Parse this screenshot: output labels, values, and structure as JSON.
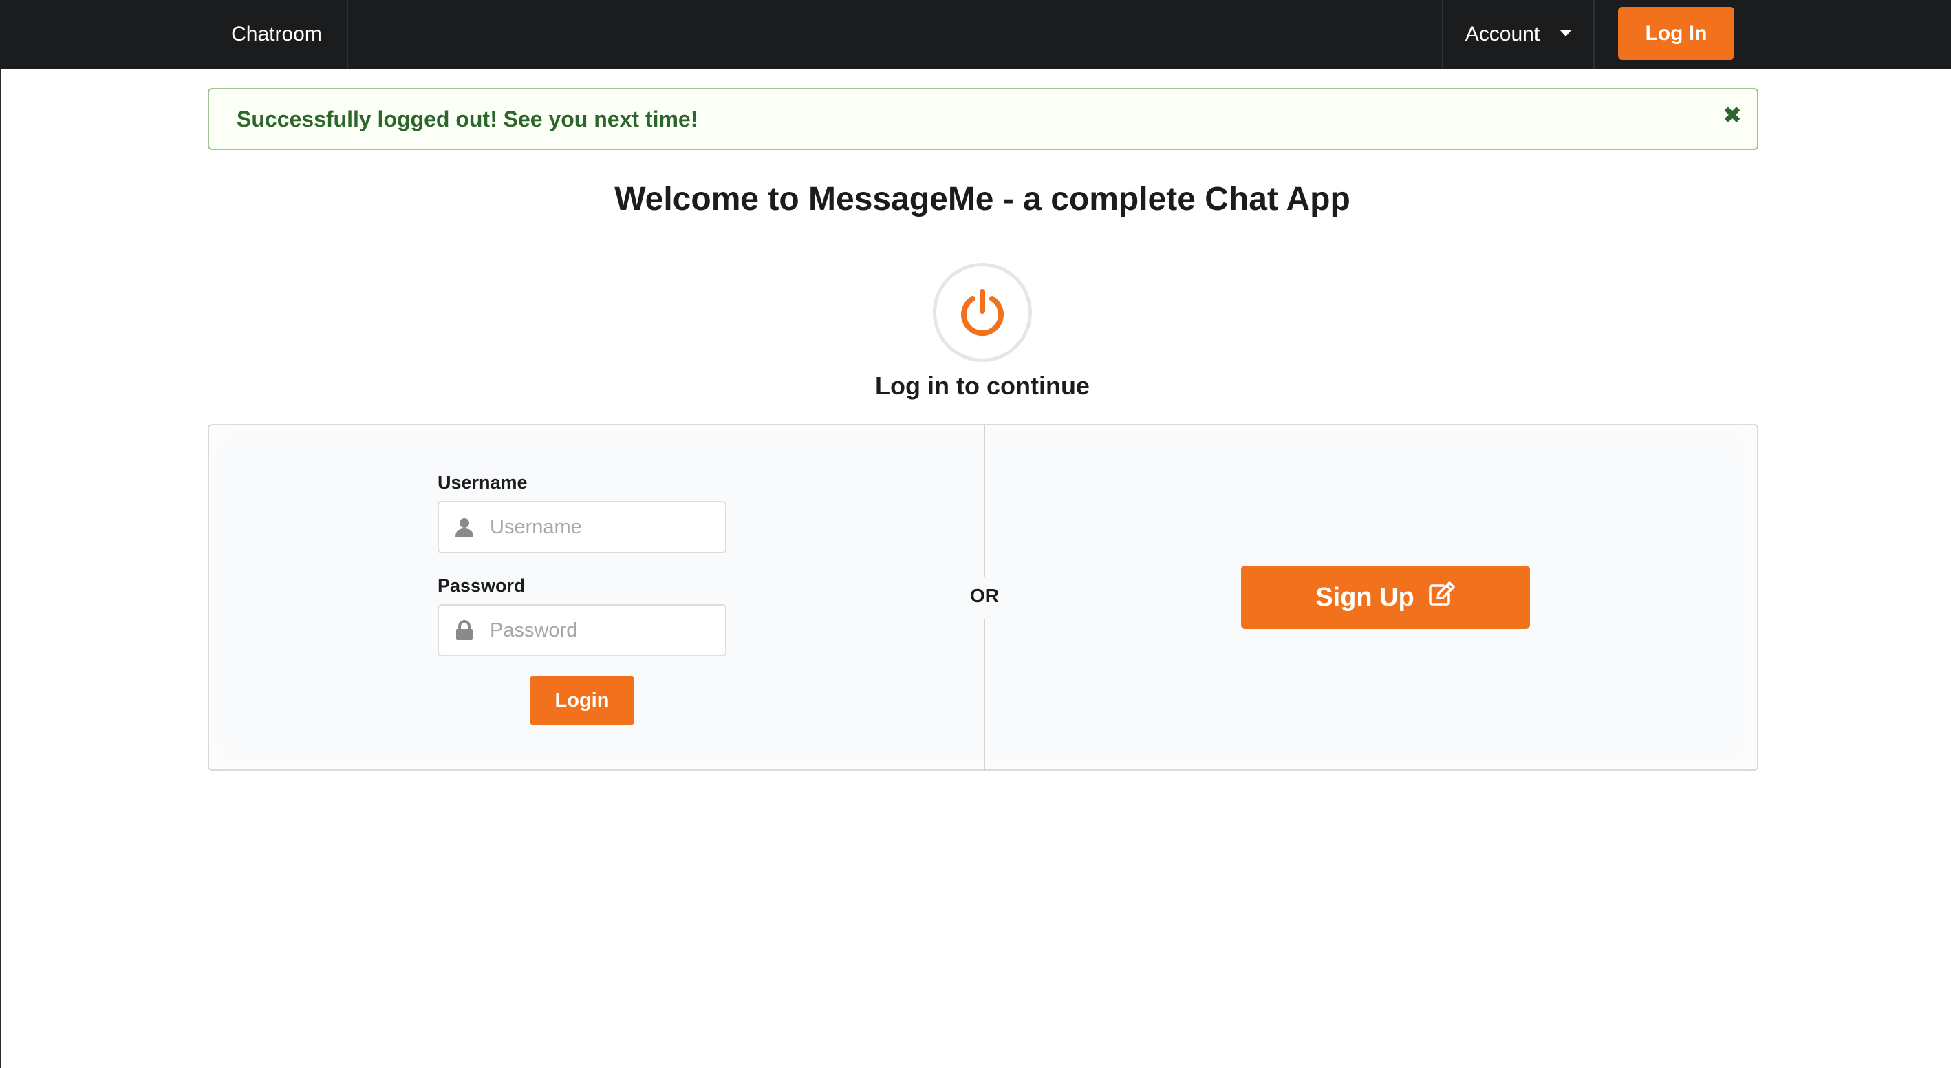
{
  "navbar": {
    "brand": "Chatroom",
    "account_label": "Account",
    "login_label": "Log In"
  },
  "message": {
    "text": "Successfully logged out! See you next time!",
    "close_glyph": "✖"
  },
  "main": {
    "title": "Welcome to MessageMe - a complete Chat App",
    "subtitle": "Log in to continue",
    "power_icon": "power-icon"
  },
  "login_form": {
    "username_label": "Username",
    "username_placeholder": "Username",
    "username_value": "",
    "password_label": "Password",
    "password_placeholder": "Password",
    "password_value": "",
    "submit_label": "Login"
  },
  "divider": {
    "text": "OR"
  },
  "signup": {
    "label": "Sign Up",
    "icon": "edit-icon"
  },
  "colors": {
    "accent": "#f2711c",
    "navbar": "#1b1c1d",
    "success_bg": "#fcfff5",
    "success_text": "#2c662d",
    "success_border": "#a3c293"
  }
}
